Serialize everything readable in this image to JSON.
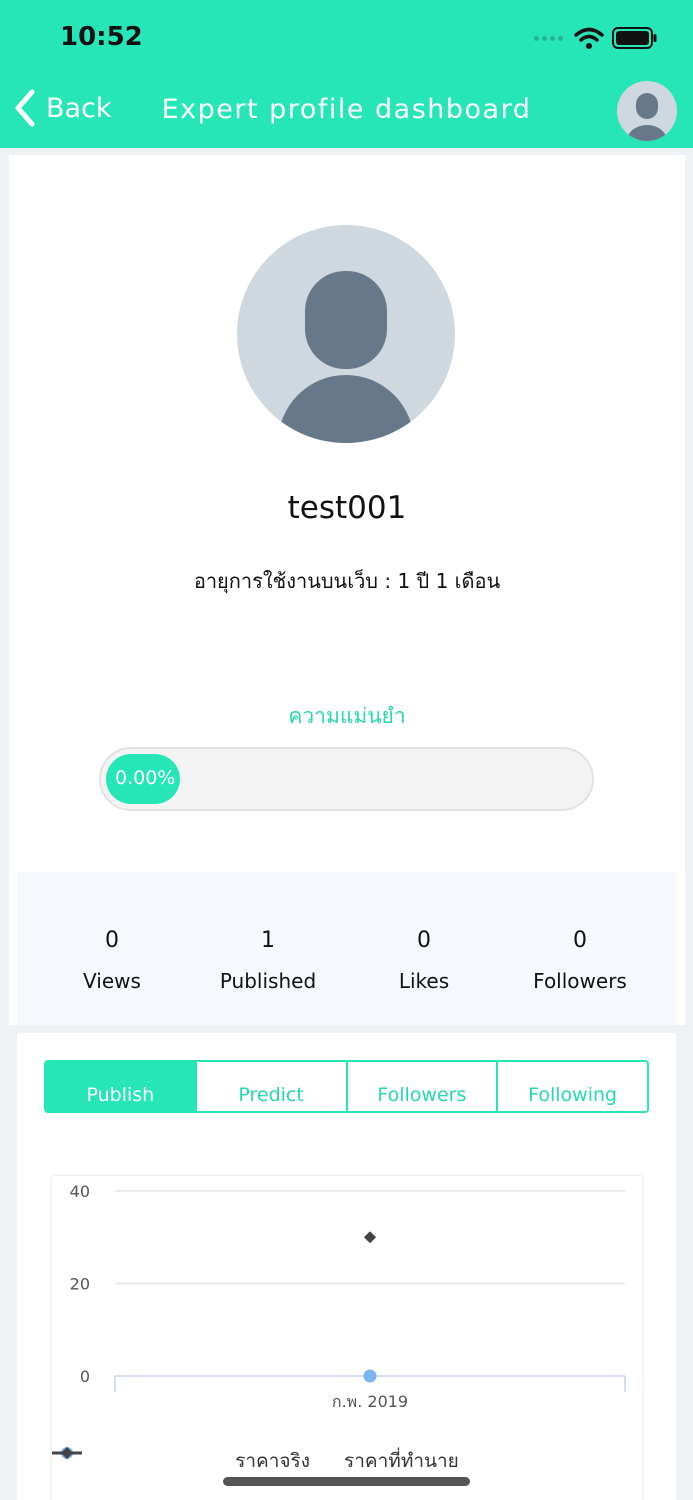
{
  "status_bar": {
    "time": "10:52"
  },
  "header": {
    "back_label": "Back",
    "title": "Expert profile dashboard"
  },
  "profile": {
    "username": "test001",
    "usage_age": "อายุการใช้งานบนเว็บ : 1 ปี 1 เดือน",
    "accuracy_label": "ความแม่นยำ",
    "accuracy_value": 0,
    "accuracy_text": "0.00%"
  },
  "stats": [
    {
      "value": "0",
      "label": "Views"
    },
    {
      "value": "1",
      "label": "Published"
    },
    {
      "value": "0",
      "label": "Likes"
    },
    {
      "value": "0",
      "label": "Followers"
    }
  ],
  "tabs": [
    {
      "label": "Publish",
      "active": true
    },
    {
      "label": "Predict",
      "active": false
    },
    {
      "label": "Followers",
      "active": false
    },
    {
      "label": "Following",
      "active": false
    }
  ],
  "chart_data": {
    "type": "line",
    "categories": [
      "ก.พ. 2019"
    ],
    "series": [
      {
        "name": "ราคาจริง",
        "values": [
          0
        ],
        "color": "#7cb5ec",
        "marker": "circle"
      },
      {
        "name": "ราคาที่ทำนาย",
        "values": [
          30
        ],
        "color": "#434348",
        "marker": "diamond"
      }
    ],
    "yticks": [
      0,
      20,
      40
    ],
    "ylim": [
      0,
      40
    ],
    "grid": true,
    "legend": "bottom"
  },
  "colors": {
    "accent": "#26e6b8",
    "avatar_bg": "#cfd8df",
    "avatar_fg": "#66788a"
  }
}
